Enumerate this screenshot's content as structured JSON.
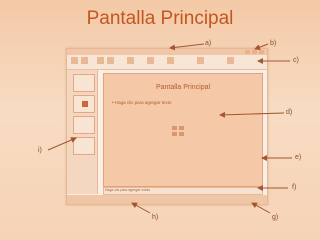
{
  "page": {
    "title": "Pantalla Principal"
  },
  "slide": {
    "title_placeholder": "Pantalla Principal",
    "bullet_placeholder": "• Haga clic para agregar texto",
    "notes_placeholder": "Haga clic para agregar notas"
  },
  "callouts": {
    "a": "a)",
    "b": "b)",
    "c": "c)",
    "d": "d)",
    "e": "e)",
    "f": "f)",
    "g": "g)",
    "h": "h)",
    "i": "i)"
  },
  "colors": {
    "title": "#c2571f",
    "arrow": "#a3562f"
  }
}
